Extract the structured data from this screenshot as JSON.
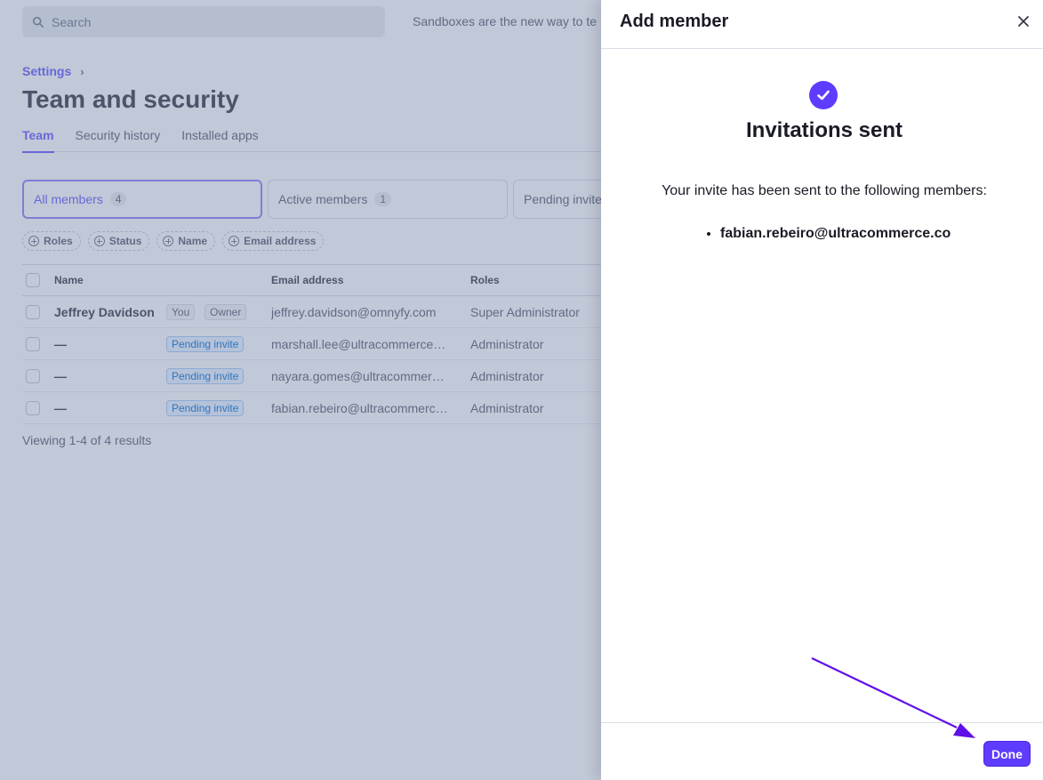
{
  "search": {
    "placeholder": "Search"
  },
  "banner": {
    "text": "Sandboxes are the new way to te"
  },
  "breadcrumb": {
    "parent": "Settings"
  },
  "page": {
    "title": "Team and security"
  },
  "tabs": [
    {
      "label": "Team",
      "active": true
    },
    {
      "label": "Security history"
    },
    {
      "label": "Installed apps"
    }
  ],
  "filters": [
    {
      "label": "All members",
      "count": "4",
      "active": true
    },
    {
      "label": "Active members",
      "count": "1"
    },
    {
      "label": "Pending invite"
    }
  ],
  "chips": [
    "Roles",
    "Status",
    "Name",
    "Email address"
  ],
  "table": {
    "headers": {
      "name": "Name",
      "email": "Email address",
      "roles": "Roles"
    },
    "rows": [
      {
        "name": "Jeffrey Davidson",
        "badges": [
          "You",
          "Owner"
        ],
        "email": "jeffrey.davidson@omnyfy.com",
        "role": "Super Administrator"
      },
      {
        "name": "—",
        "badges": [
          "Pending invite"
        ],
        "email": "marshall.lee@ultracommerce.co",
        "role": "Administrator"
      },
      {
        "name": "—",
        "badges": [
          "Pending invite"
        ],
        "email": "nayara.gomes@ultracommerce.co",
        "role": "Administrator"
      },
      {
        "name": "—",
        "badges": [
          "Pending invite"
        ],
        "email": "fabian.rebeiro@ultracommerce.co",
        "role": "Administrator"
      }
    ]
  },
  "results": "Viewing 1-4 of 4 results",
  "drawer": {
    "title": "Add member",
    "heading": "Invitations sent",
    "description": "Your invite has been sent to the following members:",
    "members": [
      "fabian.rebeiro@ultracommerce.co"
    ],
    "done_label": "Done"
  },
  "colors": {
    "accent": "#5f3cfd",
    "link": "#635bff",
    "annotation_arrow": "#5f10e8"
  },
  "icons": [
    "search-icon",
    "chevron-right-icon",
    "plus-circle-icon",
    "close-icon",
    "checkmark-icon"
  ]
}
